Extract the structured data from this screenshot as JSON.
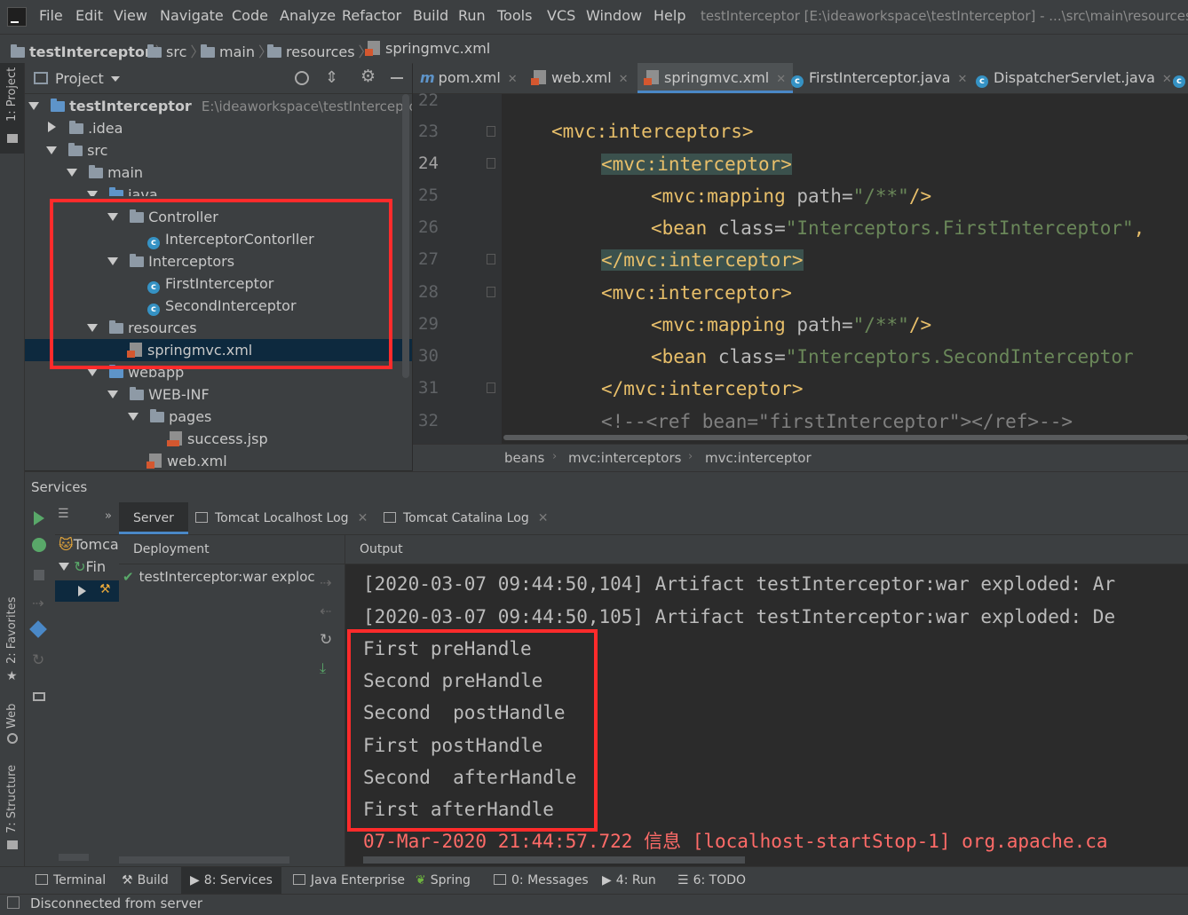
{
  "menu": [
    "File",
    "Edit",
    "View",
    "Navigate",
    "Code",
    "Analyze",
    "Refactor",
    "Build",
    "Run",
    "Tools",
    "VCS",
    "Window",
    "Help"
  ],
  "window_title": "testInterceptor [E:\\ideaworkspace\\testInterceptor] - ...\\src\\main\\resources\\",
  "nav_breadcrumb": [
    "testInterceptor",
    "src",
    "main",
    "resources",
    "springmvc.xml"
  ],
  "left_strip": [
    "1: Project",
    "2: Favorites",
    "Web",
    "7: Structure"
  ],
  "project_panel": {
    "title": "Project",
    "tree": [
      {
        "label": "testInterceptor",
        "extra": "E:\\ideaworkspace\\testInterceptor"
      },
      {
        "label": ".idea"
      },
      {
        "label": "src"
      },
      {
        "label": "main"
      },
      {
        "label": "java"
      },
      {
        "label": "Controller"
      },
      {
        "label": "InterceptorContorller"
      },
      {
        "label": "Interceptors"
      },
      {
        "label": "FirstInterceptor"
      },
      {
        "label": "SecondInterceptor"
      },
      {
        "label": "resources"
      },
      {
        "label": "springmvc.xml"
      },
      {
        "label": "webapp"
      },
      {
        "label": "WEB-INF"
      },
      {
        "label": "pages"
      },
      {
        "label": "success.jsp"
      },
      {
        "label": "web.xml"
      }
    ]
  },
  "editor_tabs": [
    "pom.xml",
    "web.xml",
    "springmvc.xml",
    "FirstInterceptor.java",
    "DispatcherServlet.java"
  ],
  "active_tab": "springmvc.xml",
  "line_numbers": [
    "22",
    "23",
    "24",
    "25",
    "26",
    "27",
    "28",
    "29",
    "30",
    "31",
    "32"
  ],
  "code": {
    "l23": "<mvc:interceptors>",
    "l24": "<mvc:interceptor>",
    "l25_tag": "<mvc:mapping ",
    "l25_attr": "path=",
    "l25_val": "\"/**\"",
    "l25_end": "/>",
    "l26_tag": "<bean ",
    "l26_attr": "class=",
    "l26_val": "\"Interceptors.FirstInterceptor\"",
    "l26_end": ",",
    "l27": "</mvc:interceptor>",
    "l28": "<mvc:interceptor>",
    "l29_tag": "<mvc:mapping ",
    "l29_attr": "path=",
    "l29_val": "\"/**\"",
    "l29_end": "/>",
    "l30_tag": "<bean ",
    "l30_attr": "class=",
    "l30_val": "\"Interceptors.SecondInterceptor",
    "l31": "</mvc:interceptor>",
    "l32": "<!--<ref bean=\"firstInterceptor\"></ref>-->"
  },
  "editor_breadcrumb": [
    "beans",
    "mvc:interceptors",
    "mvc:interceptor"
  ],
  "services": {
    "title": "Services",
    "tree": [
      "Tomca",
      "Fin"
    ],
    "tabs": [
      "Server",
      "Tomcat Localhost Log",
      "Tomcat Catalina Log"
    ],
    "deployment_header": "Deployment",
    "deployment_item": "testInterceptor:war exploc",
    "output_header": "Output",
    "output": [
      "[2020-03-07 09:44:50,104] Artifact testInterceptor:war exploded: Ar",
      "[2020-03-07 09:44:50,105] Artifact testInterceptor:war exploded: De",
      "First preHandle",
      "Second preHandle",
      "Second  postHandle",
      "First postHandle",
      "Second  afterHandle",
      "First afterHandle",
      "07-Mar-2020 21:44:57.722 信息 [localhost-startStop-1] org.apache.ca"
    ]
  },
  "bottom_tabs": [
    "Terminal",
    "Build",
    "8: Services",
    "Java Enterprise",
    "Spring",
    "0: Messages",
    "4: Run",
    "6: TODO"
  ],
  "status": "Disconnected from server",
  "colors": {
    "highlight_box": "#ff2b2b",
    "tag": "#e8bf6a",
    "string": "#6a8759",
    "error_log": "#ff6b68"
  }
}
